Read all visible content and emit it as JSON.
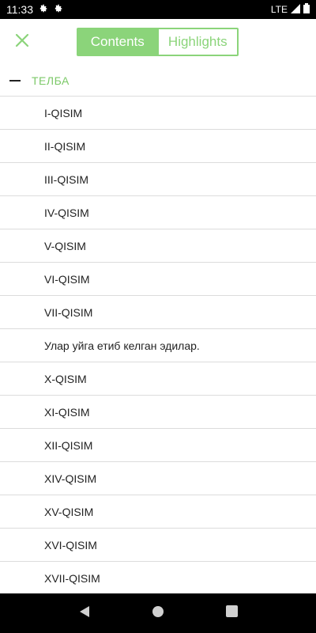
{
  "status_bar": {
    "time": "11:33",
    "network": "LTE"
  },
  "toolbar": {
    "close_icon": "close-icon",
    "tabs": [
      {
        "label": "Contents",
        "active": true
      },
      {
        "label": "Highlights",
        "active": false
      }
    ]
  },
  "contents": {
    "group_title": "ТЕЛБА",
    "items": [
      "I-QISIM",
      "II-QISIM",
      "III-QISIM",
      "IV-QISIM",
      "V-QISIM",
      "VI-QISIM",
      "VII-QISIM",
      "Улар уйга етиб келган эдилар.",
      "X-QISIM",
      "XI-QISIM",
      "XII-QISIM",
      "XIV-QISIM",
      "XV-QISIM",
      "XVI-QISIM",
      "XVII-QISIM"
    ]
  },
  "colors": {
    "accent": "#8bd47a",
    "group_title": "#7cc968"
  }
}
